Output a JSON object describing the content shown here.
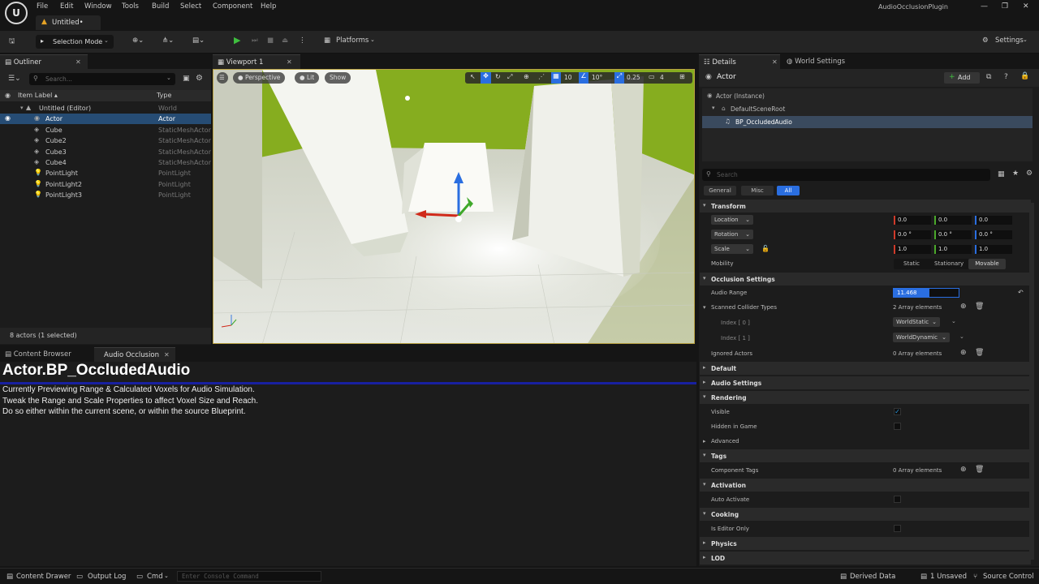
{
  "menu": [
    "File",
    "Edit",
    "Window",
    "Tools",
    "Build",
    "Select",
    "Component",
    "Help"
  ],
  "plugin_name": "AudioOcclusionPlugin",
  "doc_tab": "Untitled•",
  "toolbar": {
    "selection_mode": "Selection Mode",
    "platforms": "Platforms",
    "settings": "Settings"
  },
  "outliner": {
    "tab": "Outliner",
    "search_placeholder": "Search...",
    "col_label": "Item Label ▴",
    "col_type": "Type",
    "rows": [
      {
        "label": "Untitled (Editor)",
        "type": "World"
      },
      {
        "label": "Actor",
        "type": "Actor"
      },
      {
        "label": "Cube",
        "type": "StaticMeshActor"
      },
      {
        "label": "Cube2",
        "type": "StaticMeshActor"
      },
      {
        "label": "Cube3",
        "type": "StaticMeshActor"
      },
      {
        "label": "Cube4",
        "type": "StaticMeshActor"
      },
      {
        "label": "PointLight",
        "type": "PointLight"
      },
      {
        "label": "PointLight2",
        "type": "PointLight"
      },
      {
        "label": "PointLight3",
        "type": "PointLight"
      }
    ],
    "footer": "8 actors (1 selected)"
  },
  "viewport": {
    "tab": "Viewport 1",
    "perspective": "Perspective",
    "lit": "Lit",
    "show": "Show",
    "grid": "10",
    "angle": "10°",
    "scale": "0.25",
    "cams": "4"
  },
  "details": {
    "tab": "Details",
    "tab2": "World Settings",
    "actor": "Actor",
    "add": "Add",
    "tree": [
      "Actor (Instance)",
      "DefaultSceneRoot",
      "BP_OccludedAudio"
    ],
    "search_placeholder": "Search",
    "filters": [
      "General",
      "Misc",
      "All"
    ],
    "transform": {
      "title": "Transform",
      "location": "Location",
      "rotation": "Rotation",
      "scale": "Scale",
      "mobility": "Mobility",
      "loc": [
        "0.0",
        "0.0",
        "0.0"
      ],
      "rot": [
        "0.0 °",
        "0.0 °",
        "0.0 °"
      ],
      "scl": [
        "1.0",
        "1.0",
        "1.0"
      ],
      "mob": [
        "Static",
        "Stationary",
        "Movable"
      ]
    },
    "occlusion": {
      "title": "Occlusion Settings",
      "audio_range": "Audio Range",
      "audio_range_val": "11.468",
      "audio_range_fill": 0.55,
      "scanned": "Scanned Collider Types",
      "scanned_val": "2 Array elements",
      "idx0": "Index [ 0 ]",
      "idx0_val": "WorldStatic",
      "idx1": "Index [ 1 ]",
      "idx1_val": "WorldDynamic",
      "ignored": "Ignored Actors",
      "ignored_val": "0 Array elements"
    },
    "default": "Default",
    "audio_settings": "Audio Settings",
    "rendering": {
      "title": "Rendering",
      "visible": "Visible",
      "hidden": "Hidden in Game",
      "advanced": "Advanced"
    },
    "tags": {
      "title": "Tags",
      "component_tags": "Component Tags",
      "val": "0 Array elements"
    },
    "activation": {
      "title": "Activation",
      "auto": "Auto Activate"
    },
    "cooking": {
      "title": "Cooking",
      "editor_only": "Is Editor Only"
    },
    "physics": "Physics",
    "lod": "LOD"
  },
  "bottom": {
    "tab1": "Content Browser",
    "tab2": "Audio Occlusion",
    "heading": "Actor.BP_OccludedAudio",
    "lines": [
      "Currently Previewing Range & Calculated Voxels for Audio Simulation.",
      "Tweak the Range and Scale Properties to affect Voxel Size and Reach.",
      "Do so either within the current scene, or within the source Blueprint."
    ]
  },
  "status": {
    "drawer": "Content Drawer",
    "output": "Output Log",
    "cmd": "Cmd",
    "console_placeholder": "Enter Console Command",
    "derived": "Derived Data",
    "unsaved": "1 Unsaved",
    "source": "Source Control"
  }
}
